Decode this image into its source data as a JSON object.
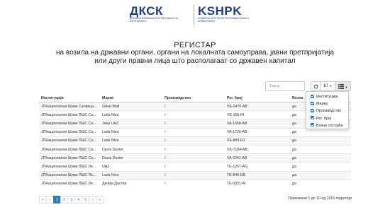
{
  "logo": {
    "left_abbr": "ДКСК",
    "left_sub": "ДРЖАВНА КОМИСИЈА ЗА СПРЕЧУВАЊЕ НА КОРУПЦИЈАТА",
    "right_abbr": "KSHPK",
    "right_sub": "KOMISIONI SHTETËROR PËR PARANDALIMIN E KORRUPSIONIT"
  },
  "title": {
    "main": "РЕГИСТАР",
    "sub": "на возила на државни органи, органи на локалната самоуправа, јавни претпријатија или други правни лица што располагаат со државен капитал"
  },
  "toolbar": {
    "search_placeholder": "Барај",
    "refresh_icon": "refresh-icon",
    "page_size": "10",
    "columns_icon": "columns-list-icon"
  },
  "columns_menu": [
    {
      "label": "Институција",
      "checked": true
    },
    {
      "label": "Марка",
      "checked": true
    },
    {
      "label": "Производство",
      "checked": true
    },
    {
      "label": "Рег. број",
      "checked": true
    },
    {
      "label": "Возна состојба",
      "checked": true
    }
  ],
  "table": {
    "headers": [
      "Институција",
      "Марка",
      "Производство",
      "Рег. број",
      "Возна"
    ],
    "rows": [
      [
        "ЈПНационални Шуми Салвица...",
        "Great Wall",
        "/",
        "VE-2470-AB",
        "да"
      ],
      [
        "ЈПНационални Шуми ПШС Са...",
        "Lada Niva",
        "/",
        "VE-156-RI",
        "да"
      ],
      [
        "ЈПНационални Шуми ПШС Са...",
        "Jeep UAZ",
        "/",
        "VA-1668-AB",
        "да"
      ],
      [
        "ЈПНационални Шуми ПШС Са...",
        "Lada Niva",
        "/",
        "VA-1726-AB",
        "да"
      ],
      [
        "ЈПНационални Шуми ПШС Са...",
        "Lada Niva",
        "/",
        "VE-883-RJ",
        "да"
      ],
      [
        "ЈПНационални Шуми ПШС Са...",
        "Dacia Duster",
        "/",
        "SK-7184-AB",
        "да"
      ],
      [
        "ЈПНационални Шуми ПШС Са...",
        "Dacia Duster",
        "/",
        "VA-2341-AB",
        "да"
      ],
      [
        "ЈПНационални Шуми ПШС Ле...",
        "UAZ",
        "/",
        "TE-1267-AG",
        "да"
      ],
      [
        "ЈПНационални Шуми ПШС Ле...",
        "Lada Niva",
        "/",
        "TE-840-DB",
        "да"
      ],
      [
        "ЈПНационални Шуми ПШС Ле...",
        "Дачија Дастер",
        "/",
        "TE-5931-AI",
        "да"
      ]
    ]
  },
  "pagination": {
    "first": "«",
    "prev": "‹",
    "pages": [
      "1",
      "2",
      "3",
      "4",
      "5"
    ],
    "active_page": "1",
    "next": "›",
    "last": "»",
    "info": "Прикажани 1 до 10 од 1916 податоци"
  }
}
